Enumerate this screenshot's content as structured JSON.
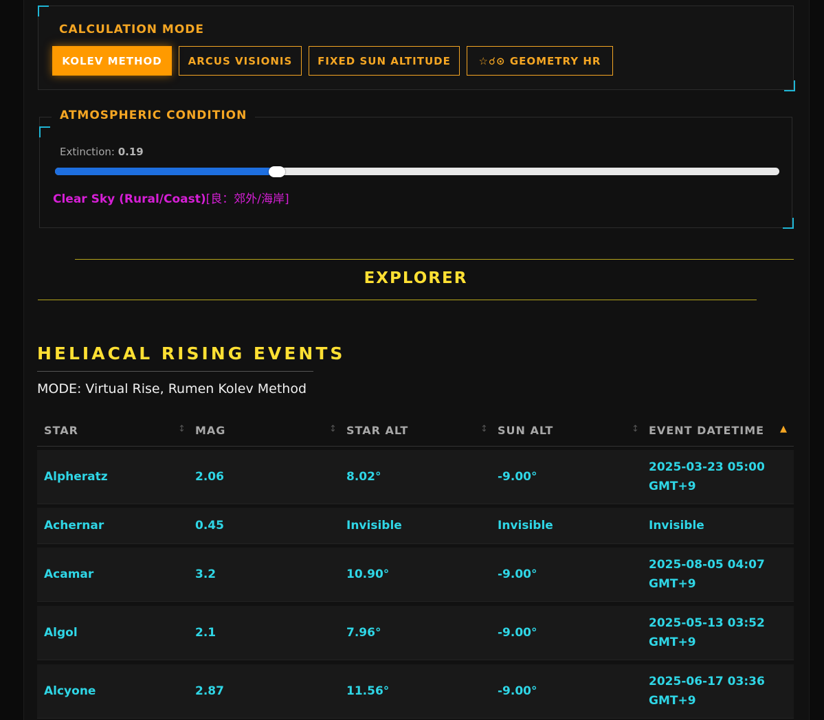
{
  "calculation": {
    "title": "CALCULATION MODE",
    "buttons": [
      "KOLEV METHOD",
      "ARCUS VISIONIS",
      "FIXED SUN ALTITUDE",
      "☆☌⊙ GEOMETRY HR"
    ],
    "active_index": 0
  },
  "atmosphere": {
    "title": "ATMOSPHERIC CONDITION",
    "extinction_label": "Extinction:",
    "extinction_value": "0.19",
    "slider_fraction": 0.306,
    "sky_text": "Clear Sky (Rural/Coast)",
    "sky_text_cjk": "[良：郊外/海岸]"
  },
  "explorer": {
    "title": "EXPLORER"
  },
  "events": {
    "title": "HELIACAL RISING EVENTS",
    "mode_text": "MODE: Virtual Rise, Rumen Kolev Method",
    "columns": [
      "STAR",
      "MAG",
      "STAR ALT",
      "SUN ALT",
      "EVENT DATETIME"
    ],
    "sort_icon": "↕",
    "sort_active_icon": "▲",
    "rows": [
      {
        "star": "Alpheratz",
        "mag": "2.06",
        "star_alt": "8.02°",
        "sun_alt": "-9.00°",
        "datetime": "2025-03-23 05:00",
        "tz": "GMT+9"
      },
      {
        "star": "Achernar",
        "mag": "0.45",
        "star_alt": "Invisible",
        "sun_alt": "Invisible",
        "datetime": "Invisible",
        "tz": ""
      },
      {
        "star": "Acamar",
        "mag": "3.2",
        "star_alt": "10.90°",
        "sun_alt": "-9.00°",
        "datetime": "2025-08-05 04:07",
        "tz": "GMT+9"
      },
      {
        "star": "Algol",
        "mag": "2.1",
        "star_alt": "7.96°",
        "sun_alt": "-9.00°",
        "datetime": "2025-05-13 03:52",
        "tz": "GMT+9"
      },
      {
        "star": "Alcyone",
        "mag": "2.87",
        "star_alt": "11.56°",
        "sun_alt": "-9.00°",
        "datetime": "2025-06-17 03:36",
        "tz": "GMT+9"
      }
    ]
  },
  "colors": {
    "accent": "#f5a623",
    "active": "#ff9a00",
    "cyan": "#2fd6e6",
    "yellow": "#ffe033",
    "magenta": "#d61fd6",
    "slider": "#1e6fe0"
  }
}
